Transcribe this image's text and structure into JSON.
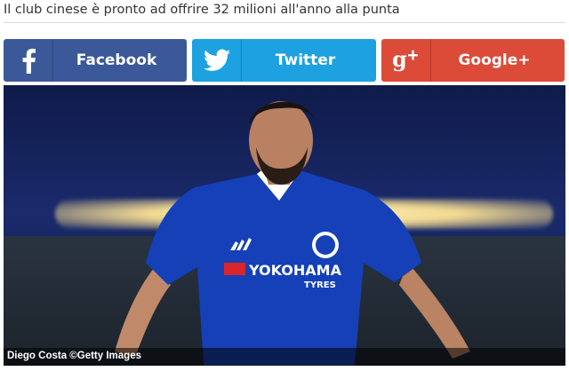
{
  "article": {
    "headline": "Il club cinese è pronto ad offrire 32 milioni all'anno alla punta"
  },
  "share": {
    "facebook": {
      "label": "Facebook",
      "color": "#3b5998",
      "icon": "facebook-icon"
    },
    "twitter": {
      "label": "Twitter",
      "color": "#1da1e0",
      "icon": "twitter-bird-icon"
    },
    "google": {
      "label": "Google+",
      "color": "#dc4a38",
      "icon": "google-plus-icon"
    }
  },
  "photo": {
    "caption": "Diego Costa ©Getty Images",
    "jersey_text": "YOKOHAMA",
    "jersey_subtext": "TYRES"
  }
}
